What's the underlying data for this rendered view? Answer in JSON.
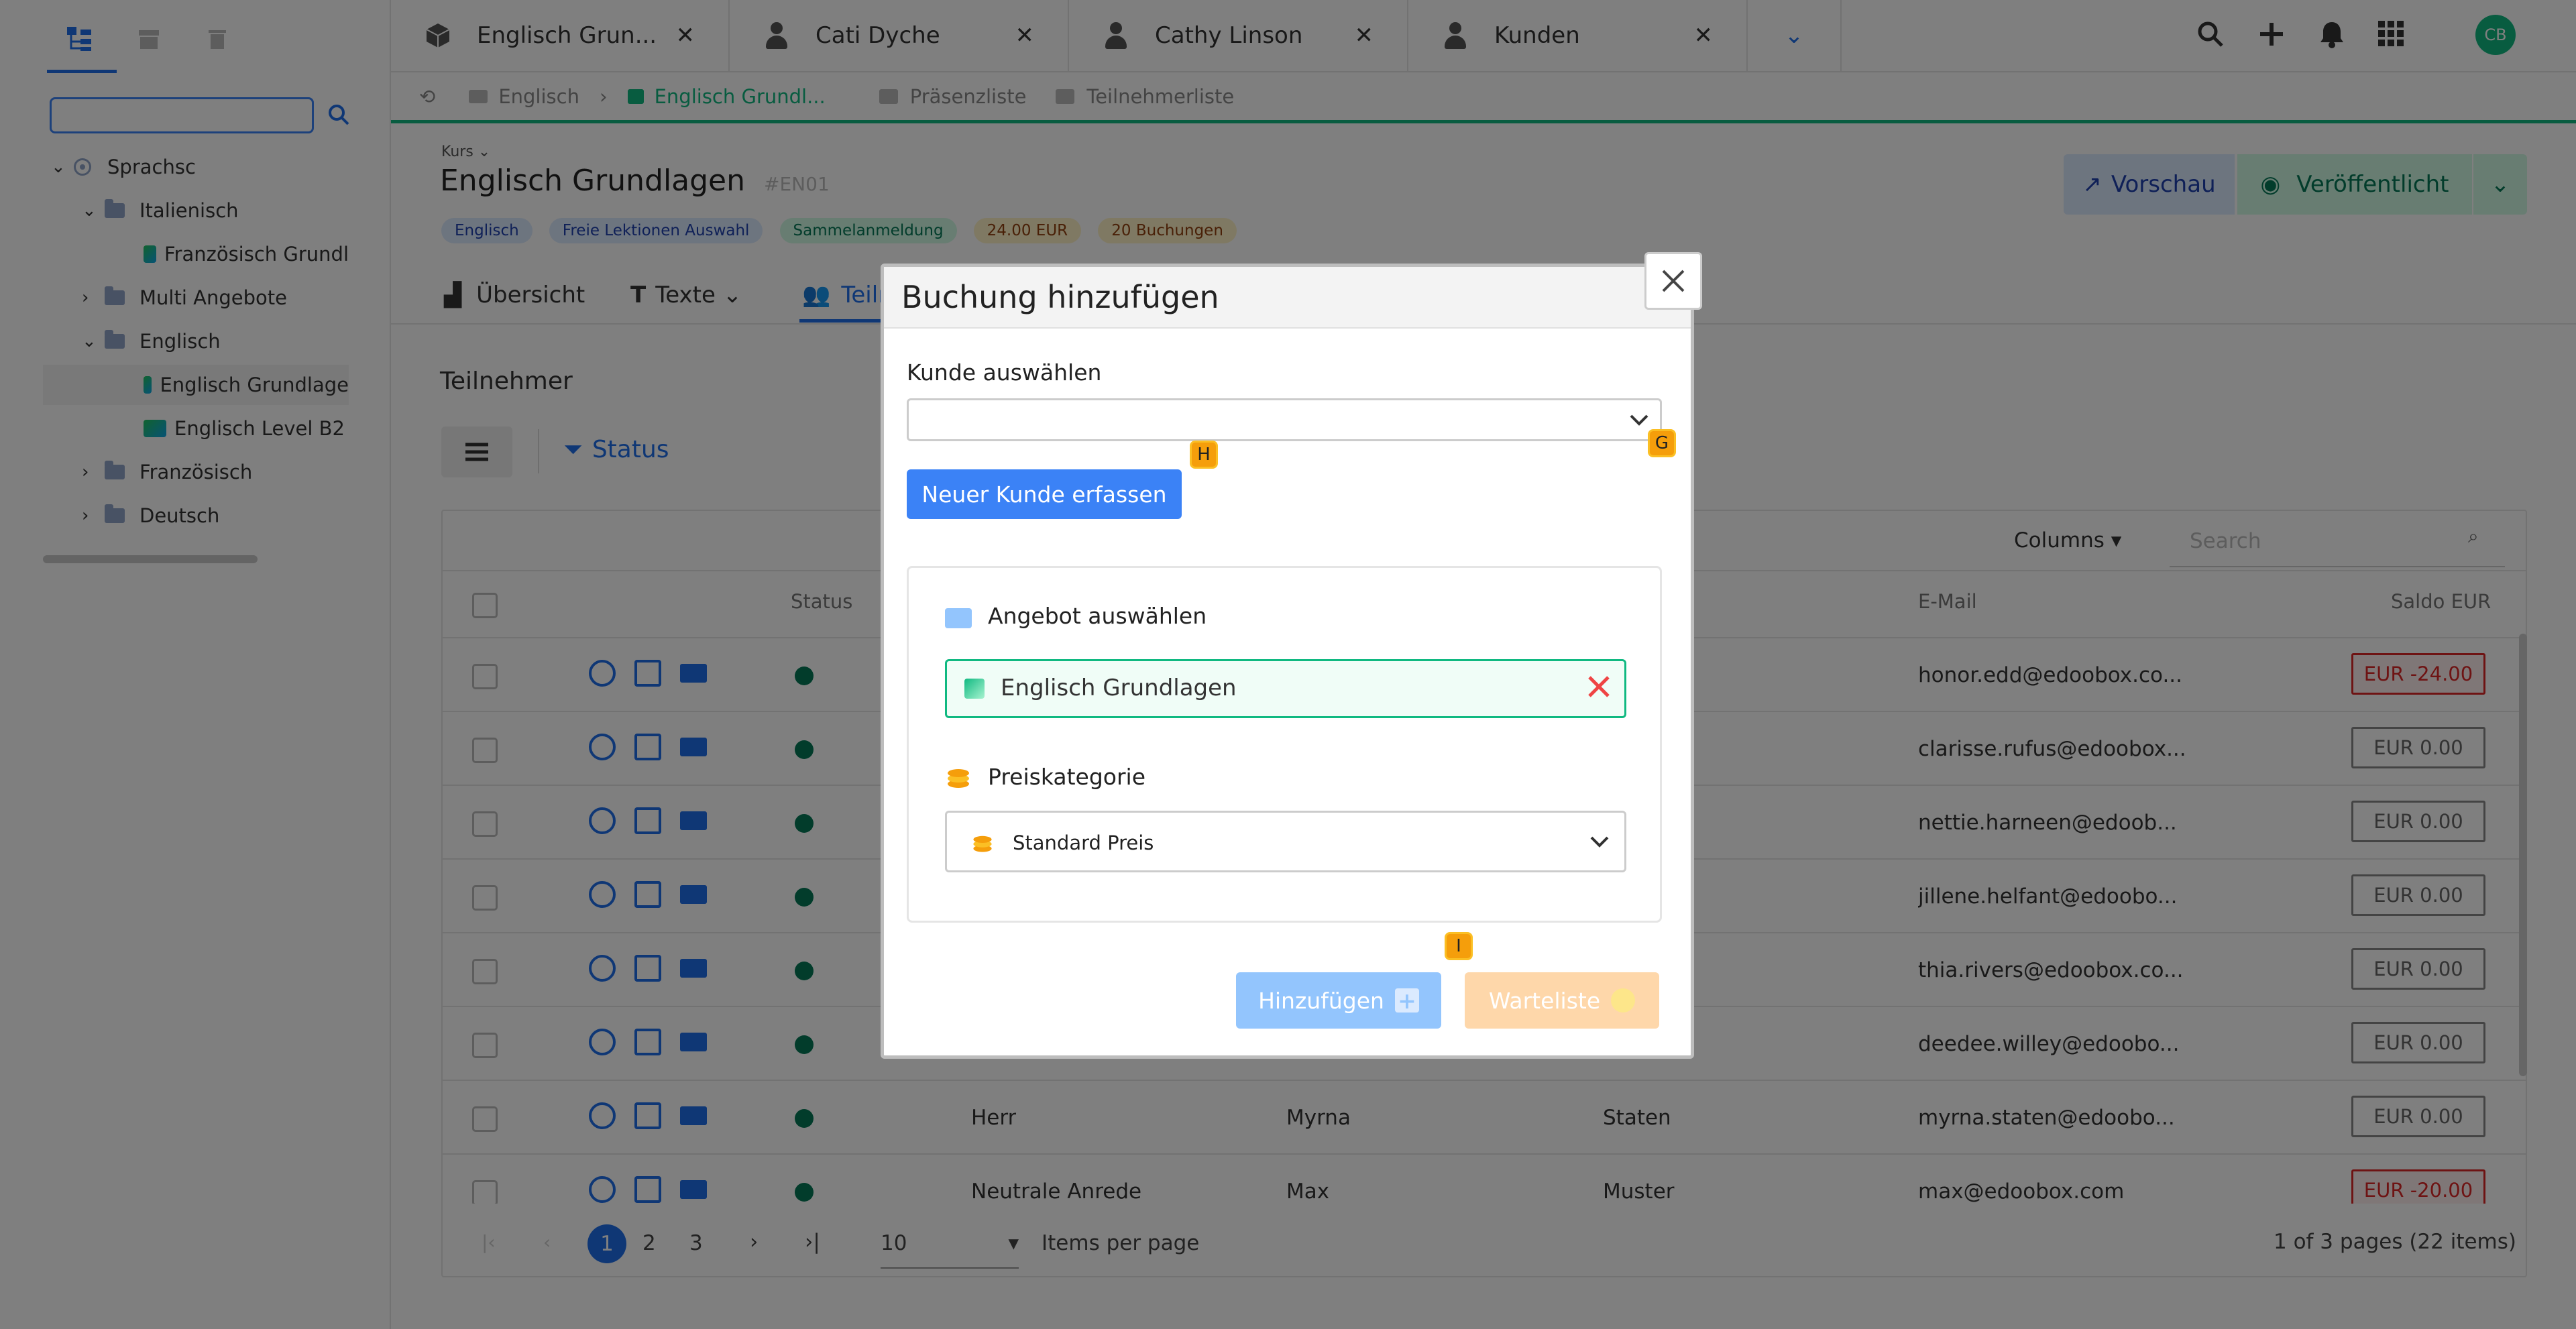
{
  "sidebar": {
    "tree": [
      {
        "label": "Sprachsc"
      },
      {
        "label": "Italienisch"
      },
      {
        "label": "Französisch Grundl"
      },
      {
        "label": "Multi Angebote"
      },
      {
        "label": "Englisch"
      },
      {
        "label": "Englisch Grundlage"
      },
      {
        "label": "Englisch Level B2"
      },
      {
        "label": "Französisch"
      },
      {
        "label": "Deutsch"
      }
    ]
  },
  "tabs": [
    {
      "label": "Englisch Grun..."
    },
    {
      "label": "Cati Dyche"
    },
    {
      "label": "Cathy Linson"
    },
    {
      "label": "Kunden"
    }
  ],
  "header": {
    "avatar": "CB"
  },
  "breadcrumb": [
    "Englisch",
    "Englisch Grundl...",
    "Präsenzliste",
    "Teilnehmerliste"
  ],
  "page": {
    "overline": "Kurs",
    "title": "Englisch Grundlagen",
    "code": "#EN01",
    "chips": [
      "Englisch",
      "Freie Lektionen Auswahl",
      "Sammelanmeldung",
      "24.00 EUR",
      "20 Buchungen"
    ],
    "preview_label": "Vorschau",
    "published_label": "Veröffentlicht",
    "tabs": [
      "Übersicht",
      "Texte",
      "Teilnehmer"
    ],
    "section_title": "Teilnehmer",
    "status_filter": "Status",
    "columns_label": "Columns",
    "search_placeholder": "Search"
  },
  "table": {
    "headers": {
      "status": "Status",
      "email": "E-Mail",
      "saldo": "Saldo EUR"
    },
    "rows": [
      {
        "email": "honor.edd@edoobox.co...",
        "saldo": "EUR -24.00",
        "neg": true
      },
      {
        "email": "clarisse.rufus@edoobox...",
        "saldo": "EUR 0.00"
      },
      {
        "email": "nettie.harneen@edoob...",
        "saldo": "EUR 0.00"
      },
      {
        "email": "jillene.helfant@edoobo...",
        "saldo": "EUR 0.00"
      },
      {
        "email": "thia.rivers@edoobox.co...",
        "saldo": "EUR 0.00"
      },
      {
        "email": "deedee.willey@edoobo...",
        "saldo": "EUR 0.00"
      },
      {
        "salutation": "Herr",
        "first": "Myrna",
        "last": "Staten",
        "email": "myrna.staten@edoobo...",
        "saldo": "EUR 0.00"
      },
      {
        "salutation": "Neutrale Anrede",
        "first": "Max",
        "last": "Muster",
        "email": "max@edoobox.com",
        "saldo": "EUR -20.00",
        "neg": true
      }
    ]
  },
  "pagination": {
    "pages": [
      "1",
      "2",
      "3"
    ],
    "per_page": "10",
    "per_page_label": "Items per page",
    "summary": "1 of 3 pages (22 items)"
  },
  "modal": {
    "title": "Buchung hinzufügen",
    "customer_label": "Kunde auswählen",
    "new_customer_button": "Neuer Kunde erfassen",
    "offer_label": "Angebot auswählen",
    "offer_value": "Englisch Grundlagen",
    "price_label": "Preiskategorie",
    "price_value": "Standard Preis",
    "add_button": "Hinzufügen",
    "waitlist_button": "Warteliste",
    "hints": [
      "H",
      "G",
      "I"
    ]
  },
  "colors": {
    "accent": "#3b82f6",
    "green": "#10b981",
    "orange": "#fdba74"
  }
}
